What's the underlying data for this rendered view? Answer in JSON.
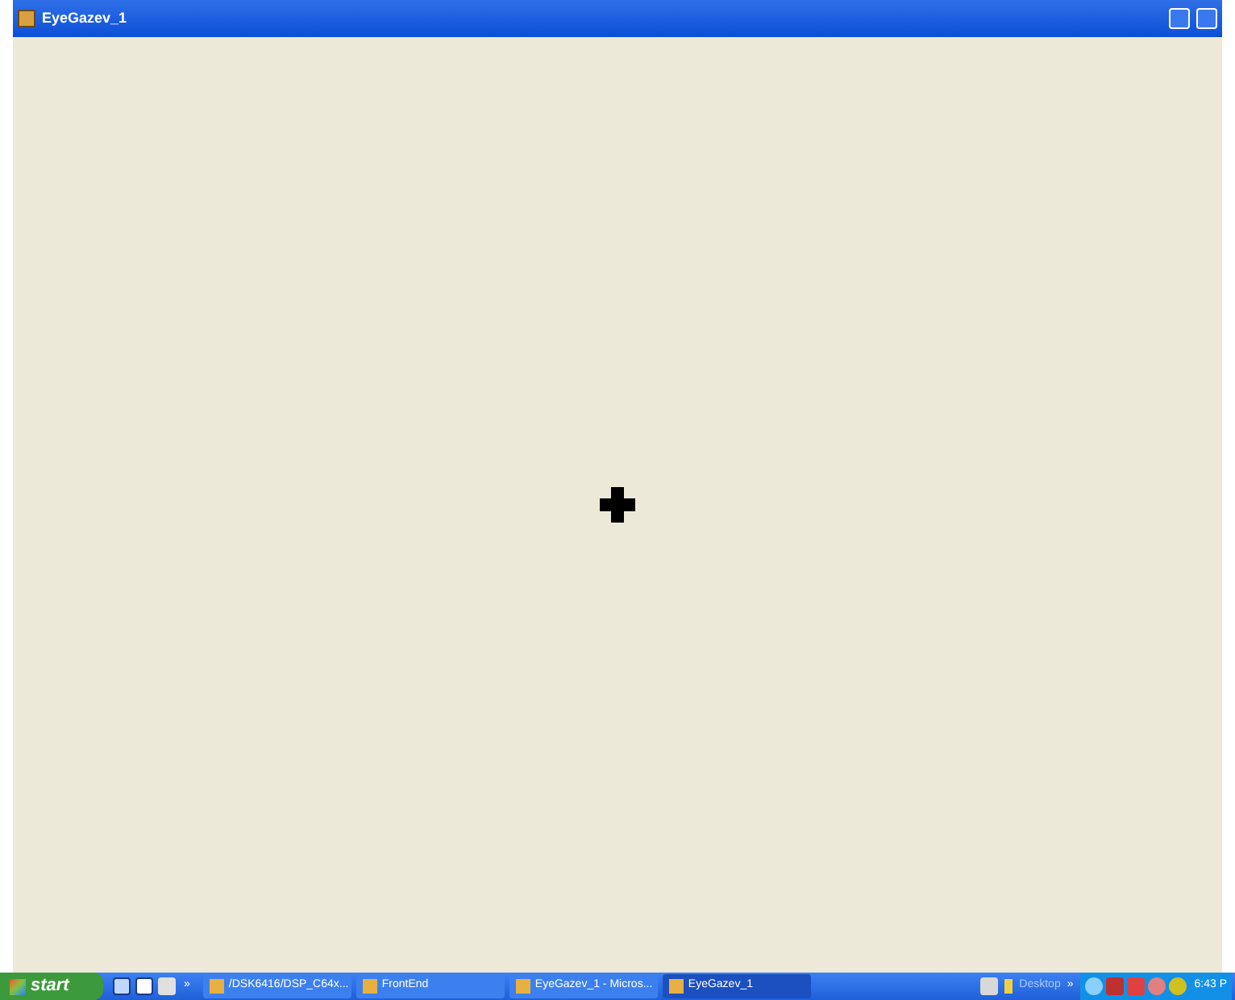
{
  "window": {
    "title": "EyeGazev_1"
  },
  "taskbar": {
    "start": "start",
    "overflow": "»",
    "tasks": [
      {
        "label": "/DSK6416/DSP_C64x...",
        "selected": false
      },
      {
        "label": "FrontEnd",
        "selected": false
      },
      {
        "label": "EyeGazev_1 - Micros...",
        "selected": false
      },
      {
        "label": "EyeGazev_1",
        "selected": true
      }
    ],
    "toolbar": "Desktop",
    "tray_overflow": "»",
    "clock": "6:43 P"
  }
}
